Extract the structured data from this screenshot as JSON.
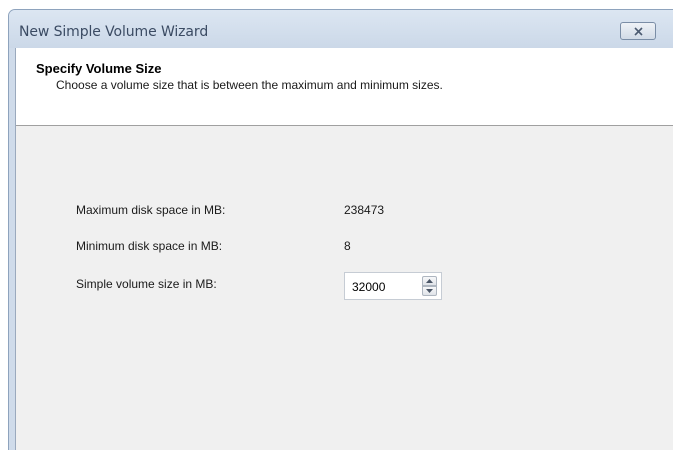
{
  "window": {
    "title": "New Simple Volume Wizard",
    "close_icon": "close-icon"
  },
  "header": {
    "title": "Specify Volume Size",
    "subtitle": "Choose a volume size that is between the maximum and minimum sizes."
  },
  "form": {
    "max_label": "Maximum disk space in MB:",
    "max_value": "238473",
    "min_label": "Minimum disk space in MB:",
    "min_value": "8",
    "size_label": "Simple volume size in MB:",
    "size_value": "32000"
  },
  "icons": {
    "spin_up": "chevron-up-icon",
    "spin_down": "chevron-down-icon"
  }
}
